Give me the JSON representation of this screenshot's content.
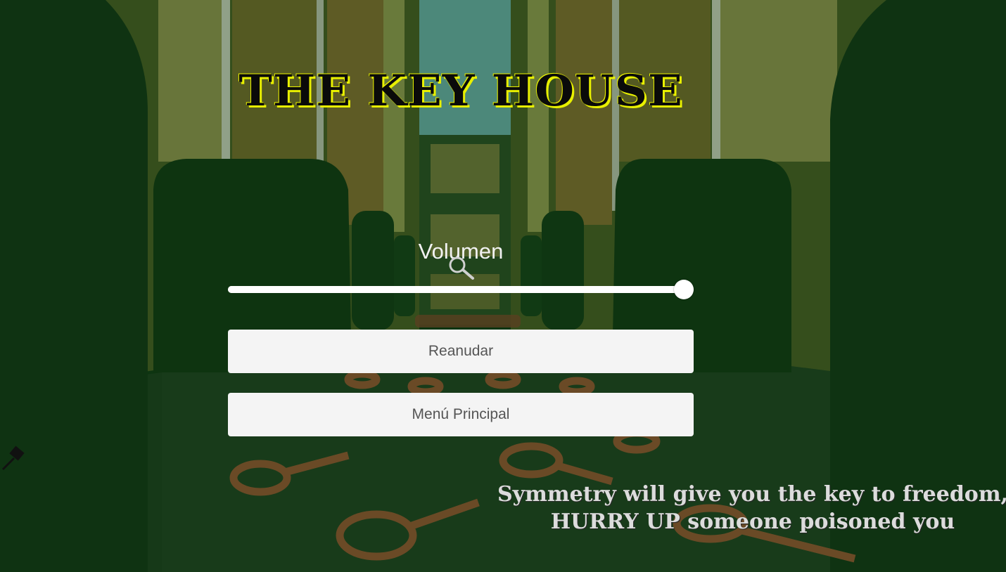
{
  "game": {
    "title": "THE KEY HOUSE"
  },
  "pause_menu": {
    "volume_label": "Volumen",
    "volume_value": 1.0,
    "resume_label": "Reanudar",
    "main_menu_label": "Menú Principal"
  },
  "hint": {
    "line1": "Symmetry will give you the key to freedom,",
    "line2": "HURRY UP someone poisoned you"
  },
  "colors": {
    "title_fill": "#0a0a0a",
    "title_outline": "#e8f000",
    "button_bg": "#f4f4f4",
    "button_text": "#555555",
    "scene_green": "#0f3312"
  },
  "icons": [
    "magnifier-icon",
    "hammer-cursor-icon"
  ]
}
